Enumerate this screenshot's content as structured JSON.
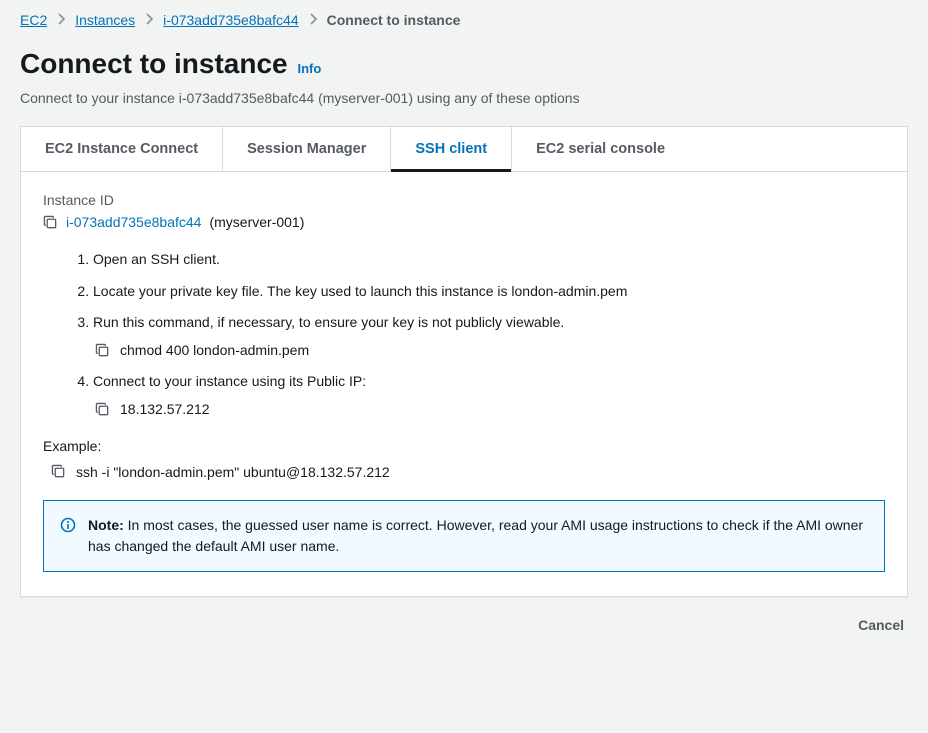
{
  "breadcrumb": {
    "ec2": "EC2",
    "instances": "Instances",
    "instance_id": "i-073add735e8bafc44",
    "current": "Connect to instance"
  },
  "header": {
    "title": "Connect to instance",
    "info": "Info",
    "subtitle": "Connect to your instance i-073add735e8bafc44 (myserver-001) using any of these options"
  },
  "tabs": {
    "ec2_connect": "EC2 Instance Connect",
    "session_manager": "Session Manager",
    "ssh_client": "SSH client",
    "serial_console": "EC2 serial console"
  },
  "body": {
    "instance_id_label": "Instance ID",
    "instance_id": "i-073add735e8bafc44",
    "instance_alias": "(myserver-001)",
    "steps": {
      "s1": "Open an SSH client.",
      "s2": "Locate your private key file. The key used to launch this instance is london-admin.pem",
      "s3": "Run this command, if necessary, to ensure your key is not publicly viewable.",
      "s3_cmd": "chmod 400 london-admin.pem",
      "s4": "Connect to your instance using its Public IP:",
      "s4_ip": "18.132.57.212"
    },
    "example_label": "Example:",
    "example_cmd": "ssh -i \"london-admin.pem\" ubuntu@18.132.57.212",
    "note_strong": "Note:",
    "note_text": " In most cases, the guessed user name is correct. However, read your AMI usage instructions to check if the AMI owner has changed the default AMI user name."
  },
  "footer": {
    "cancel": "Cancel"
  }
}
